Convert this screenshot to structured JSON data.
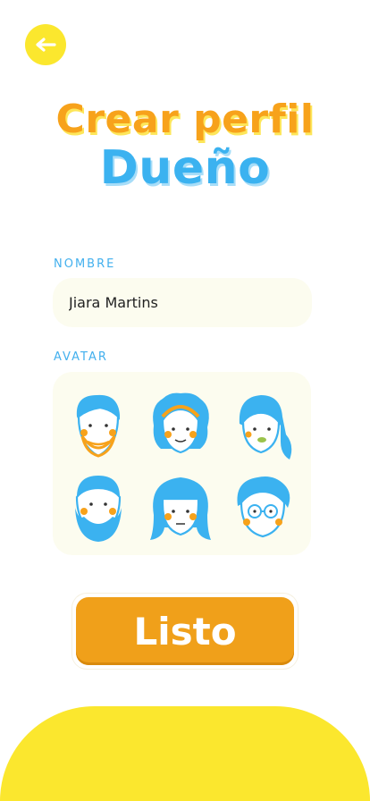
{
  "header": {
    "back_icon": "arrow-left-icon",
    "title_line1": "Crear perfil",
    "title_line2": "Dueño"
  },
  "form": {
    "name_label": "NOMBRE",
    "name_value": "Jiara Martins",
    "avatar_label": "AVATAR",
    "avatars": [
      "avatar-man-beard-orange",
      "avatar-woman-curly-hair",
      "avatar-woman-ponytail",
      "avatar-man-full-beard",
      "avatar-woman-bangs",
      "avatar-man-glasses"
    ]
  },
  "actions": {
    "done_label": "Listo"
  },
  "colors": {
    "yellow": "#fbe72e",
    "orange": "#f0a01a",
    "blue": "#3bb2f0",
    "panel": "#fcfcef"
  }
}
